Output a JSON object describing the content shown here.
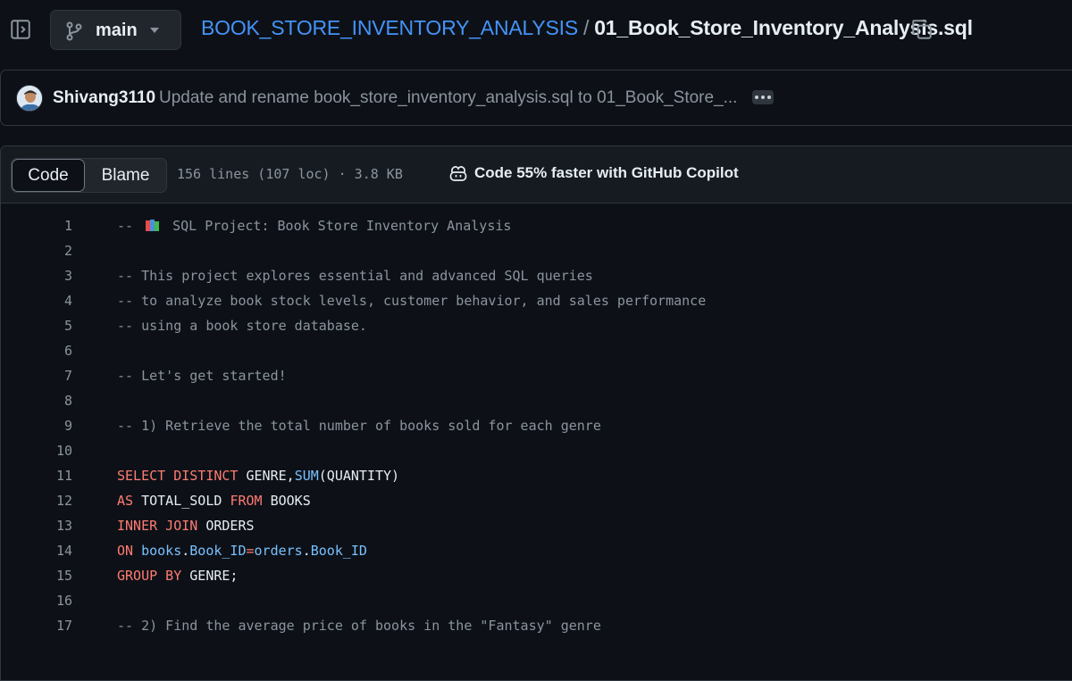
{
  "header": {
    "branch": "main",
    "repo": "BOOK_STORE_INVENTORY_ANALYSIS",
    "separator": "/",
    "file": "01_Book_Store_Inventory_Analysis.sql"
  },
  "commit": {
    "author": "Shivang3110",
    "message": "Update and rename book_store_inventory_analysis.sql to 01_Book_Store_..."
  },
  "file_header": {
    "tab_code": "Code",
    "tab_blame": "Blame",
    "stats": "156 lines (107 loc) · 3.8 KB",
    "copilot": "Code 55% faster with GitHub Copilot"
  },
  "code_lines": [
    {
      "n": "1",
      "t": [
        {
          "c": "c",
          "s": "-- "
        },
        {
          "c": "emoji",
          "s": "books"
        },
        {
          "c": "c",
          "s": " SQL Project: Book Store Inventory Analysis"
        }
      ]
    },
    {
      "n": "2",
      "t": []
    },
    {
      "n": "3",
      "t": [
        {
          "c": "c",
          "s": "-- This project explores essential and advanced SQL queries"
        }
      ]
    },
    {
      "n": "4",
      "t": [
        {
          "c": "c",
          "s": "-- to analyze book stock levels, customer behavior, and sales performance"
        }
      ]
    },
    {
      "n": "5",
      "t": [
        {
          "c": "c",
          "s": "-- using a book store database."
        }
      ]
    },
    {
      "n": "6",
      "t": []
    },
    {
      "n": "7",
      "t": [
        {
          "c": "c",
          "s": "-- Let's get started!"
        }
      ]
    },
    {
      "n": "8",
      "t": []
    },
    {
      "n": "9",
      "t": [
        {
          "c": "c",
          "s": "-- 1) Retrieve the total number of books sold for each genre"
        }
      ]
    },
    {
      "n": "10",
      "t": []
    },
    {
      "n": "11",
      "t": [
        {
          "c": "k",
          "s": "SELECT DISTINCT "
        },
        {
          "c": "p",
          "s": "GENRE,"
        },
        {
          "c": "f",
          "s": "SUM"
        },
        {
          "c": "p",
          "s": "(QUANTITY)"
        }
      ]
    },
    {
      "n": "12",
      "t": [
        {
          "c": "k",
          "s": "AS "
        },
        {
          "c": "p",
          "s": "TOTAL_SOLD "
        },
        {
          "c": "k",
          "s": "FROM "
        },
        {
          "c": "p",
          "s": "BOOKS"
        }
      ]
    },
    {
      "n": "13",
      "t": [
        {
          "c": "k",
          "s": "INNER JOIN "
        },
        {
          "c": "p",
          "s": "ORDERS"
        }
      ]
    },
    {
      "n": "14",
      "t": [
        {
          "c": "k",
          "s": "ON "
        },
        {
          "c": "f",
          "s": "books"
        },
        {
          "c": "p",
          "s": "."
        },
        {
          "c": "f",
          "s": "Book_ID"
        },
        {
          "c": "k",
          "s": "="
        },
        {
          "c": "f",
          "s": "orders"
        },
        {
          "c": "p",
          "s": "."
        },
        {
          "c": "f",
          "s": "Book_ID"
        }
      ]
    },
    {
      "n": "15",
      "t": [
        {
          "c": "k",
          "s": "GROUP BY "
        },
        {
          "c": "p",
          "s": "GENRE;"
        }
      ]
    },
    {
      "n": "16",
      "t": []
    },
    {
      "n": "17",
      "t": [
        {
          "c": "c",
          "s": "-- 2) Find the average price of books in the \"Fantasy\" genre"
        }
      ]
    }
  ]
}
